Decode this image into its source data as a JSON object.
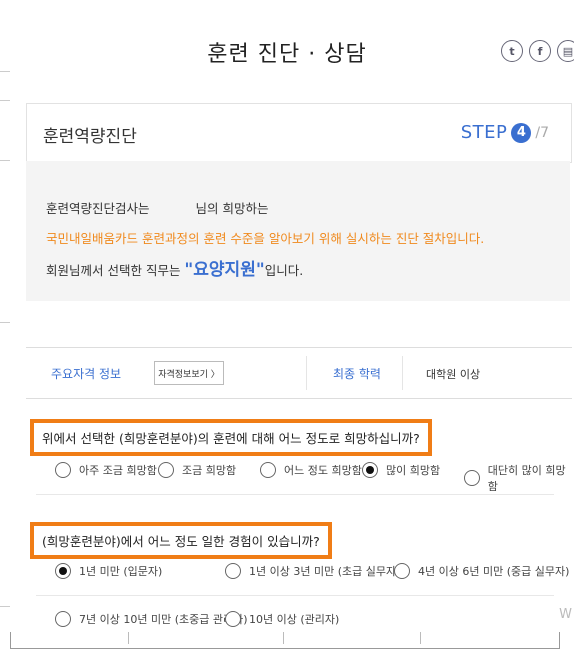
{
  "header": {
    "title": "훈련 진단 · 상담",
    "share_icons": [
      "twitter-icon",
      "facebook-icon",
      "blog-icon"
    ]
  },
  "step_box": {
    "title": "훈련역량진단",
    "step_label": "STEP",
    "step_number": "4",
    "step_total": "/7"
  },
  "intro": {
    "line1_part1": "훈련역량진단검사는",
    "line1_part2": "님의 희망하는",
    "line2": "국민내일배움카드 훈련과정의 훈련 수준을 알아보기 위해 실시하는 진단 절차입니다.",
    "line3_prefix": "회원님께서 선택한 직무는 ",
    "line3_job": "\"요양지원\"",
    "line3_suffix": "입니다."
  },
  "info_bar": {
    "cert_label": "주요자격 정보",
    "cert_button": "자격정보보기 〉",
    "edu_label": "최종 학력",
    "edu_value": "대학원 이상"
  },
  "q1": {
    "text": "위에서 선택한 (희망훈련분야)의 훈련에 대해 어느 정도로 희망하십니까?",
    "options": [
      "아주 조금 희망함",
      "조금 희망함",
      "어느 정도 희망함",
      "많이 희망함",
      "대단히 많이 희망함"
    ],
    "selected_index": 3
  },
  "q2": {
    "text": "(희망훈련분야)에서 어느 정도 일한 경험이 있습니까?",
    "options": [
      "1년 미만 (입문자)",
      "1년 이상 3년 미만 (초급 실무자)",
      "4년 이상 6년 미만 (중급 실무자)",
      "7년 이상 10년 미만 (초중급 관리자)",
      "10년 이상 (관리자)"
    ],
    "selected_index": 0
  },
  "colors": {
    "accent_blue": "#3a6fd0",
    "accent_orange": "#f07d16"
  }
}
